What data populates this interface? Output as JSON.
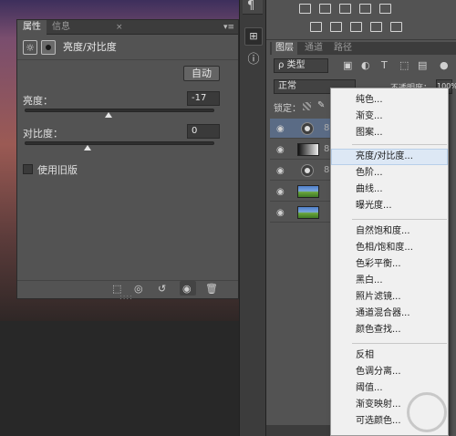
{
  "properties_panel": {
    "tabs": [
      "属性",
      "信息"
    ],
    "close_glyph": "×",
    "menu_glyph": "▾≡",
    "title": "亮度/对比度",
    "auto_button": "自动",
    "brightness_label": "亮度：",
    "brightness_value": "-17",
    "brightness_level": -17,
    "contrast_label": "对比度：",
    "contrast_value": "0",
    "contrast_level": 0,
    "legacy_label": "使用旧版"
  },
  "mid_toolbar": {
    "paragraph_glyph": "¶",
    "info_glyph": "ⓘ"
  },
  "layers_panel": {
    "tabs": [
      "图层",
      "通道",
      "路径"
    ],
    "kind_filter": "ρ 类型",
    "blend_mode": "正常",
    "opacity_label": "不透明度：",
    "opacity_value": "100%",
    "lock_label": "锁定："
  },
  "context_menu": {
    "groups": [
      [
        "纯色...",
        "渐变...",
        "图案..."
      ],
      [
        "亮度/对比度...",
        "色阶...",
        "曲线...",
        "曝光度..."
      ],
      [
        "自然饱和度...",
        "色相/饱和度...",
        "色彩平衡...",
        "黑白...",
        "照片滤镜...",
        "通道混合器...",
        "颜色查找..."
      ],
      [
        "反相",
        "色调分离...",
        "阈值...",
        "渐变映射...",
        "可选颜色..."
      ]
    ],
    "highlighted": "亮度/对比度..."
  },
  "colors": {
    "panel": "#535353",
    "menu_bg": "#f0f0f0",
    "highlight": "#dde8f5"
  }
}
